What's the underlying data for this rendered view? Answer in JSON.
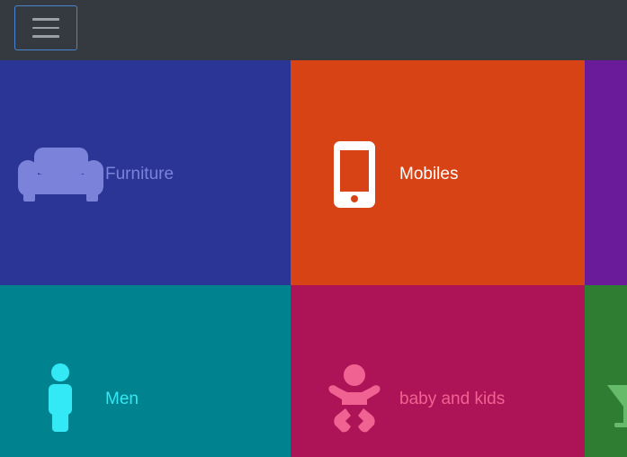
{
  "navbar": {
    "toggler_icon": "hamburger-menu-icon",
    "background": "#343a40"
  },
  "tiles": [
    {
      "label": "Furniture",
      "icon": "sofa-icon",
      "background": "#2b3595",
      "color": "#7b82d9"
    },
    {
      "label": "Mobiles",
      "icon": "mobile-phone-icon",
      "background": "#d84315",
      "color": "#ffffff"
    },
    {
      "label": "",
      "icon": "",
      "background": "#6a1b9a",
      "color": "#ffffff"
    },
    {
      "label": "Men",
      "icon": "man-icon",
      "background": "#00838f",
      "color": "#32e9f5"
    },
    {
      "label": "baby and kids",
      "icon": "baby-icon",
      "background": "#ad1457",
      "color": "#f06292"
    },
    {
      "label": "",
      "icon": "cocktail-glass-icon",
      "background": "#2e7d32",
      "color": "#66bb6a"
    }
  ]
}
